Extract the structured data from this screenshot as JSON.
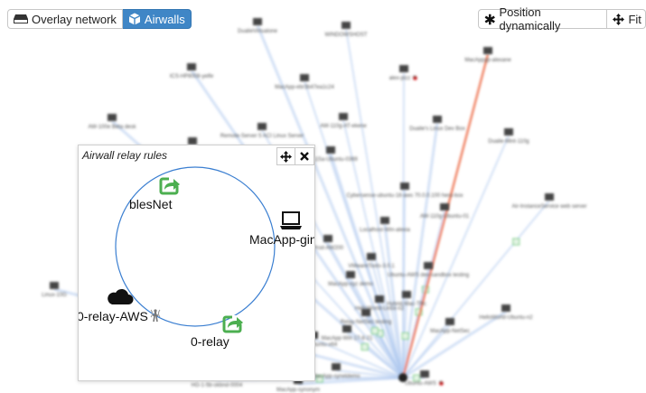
{
  "toolbar": {
    "overlay_label": "Overlay network",
    "airwalls_label": "Airwalls",
    "position_label": "Position dynamically",
    "fit_label": "Fit"
  },
  "background_labels": [
    "DualieVirtualone",
    "WINDOWSHOST",
    "MacAppyp-alexane",
    "ICS-HP8008-yelfe",
    "MacApp-ebr3b47ea1c24",
    "alex-pizz 🐞",
    "AW-100e Beta desk",
    "Remote-Server 5 ACI Linux Server",
    "AW-110g-AT-ekene",
    "Dualie's Linux Dev Box",
    "Dualie-Mint-110g",
    "Vector-AW-100",
    "HP 115a-Ubuntu-0369",
    "Cybersense-ubuntu-18-aws 70.0.0.100 hero-box",
    "Air-InstanceService web server",
    "Localhost-Win-alexia",
    "AW-110g-Ubuntu-01",
    "Prod-AW200",
    "Linux-10G",
    "VMwareTools-3.0.1",
    "MacApp-xyz demo",
    "HelloWorld-Ubuntu-n2",
    "Ubuntu-AWS dev-sandbox testing",
    "HelloWorld-Linux-n2",
    "Relay-NetSec testing",
    "MacApp-NetSec",
    "Hybrid-Mac-TRc",
    "MacApp-synonym",
    "MacApp-Win 17-8-21",
    "Ubuntu-Ubuntu-x64",
    "HG-1-5b-okbnd-0004",
    "MacApp-syneldemo",
    "Ubuntu-AWS 🐞"
  ],
  "panel": {
    "title": "Airwall relay rules",
    "move_icon": "move-icon",
    "close_icon": "close-icon",
    "nodes": [
      {
        "label": "blesNet",
        "icon": "relay-share-icon"
      },
      {
        "label": "MacApp-gina-",
        "icon": "laptop-icon"
      },
      {
        "label": "0-relay",
        "icon": "relay-share-icon"
      },
      {
        "label": "0-relay-AWS",
        "icon": "cloud-icon",
        "badge": "tower-icon"
      }
    ],
    "ring_color": "#3b7fd1",
    "relay_color": "#4caf50"
  },
  "colors": {
    "accent": "#3f86c6",
    "edge_blue": "#aec8ef",
    "edge_highlight": "#f08060",
    "badge_green": "#6ecb7c"
  }
}
